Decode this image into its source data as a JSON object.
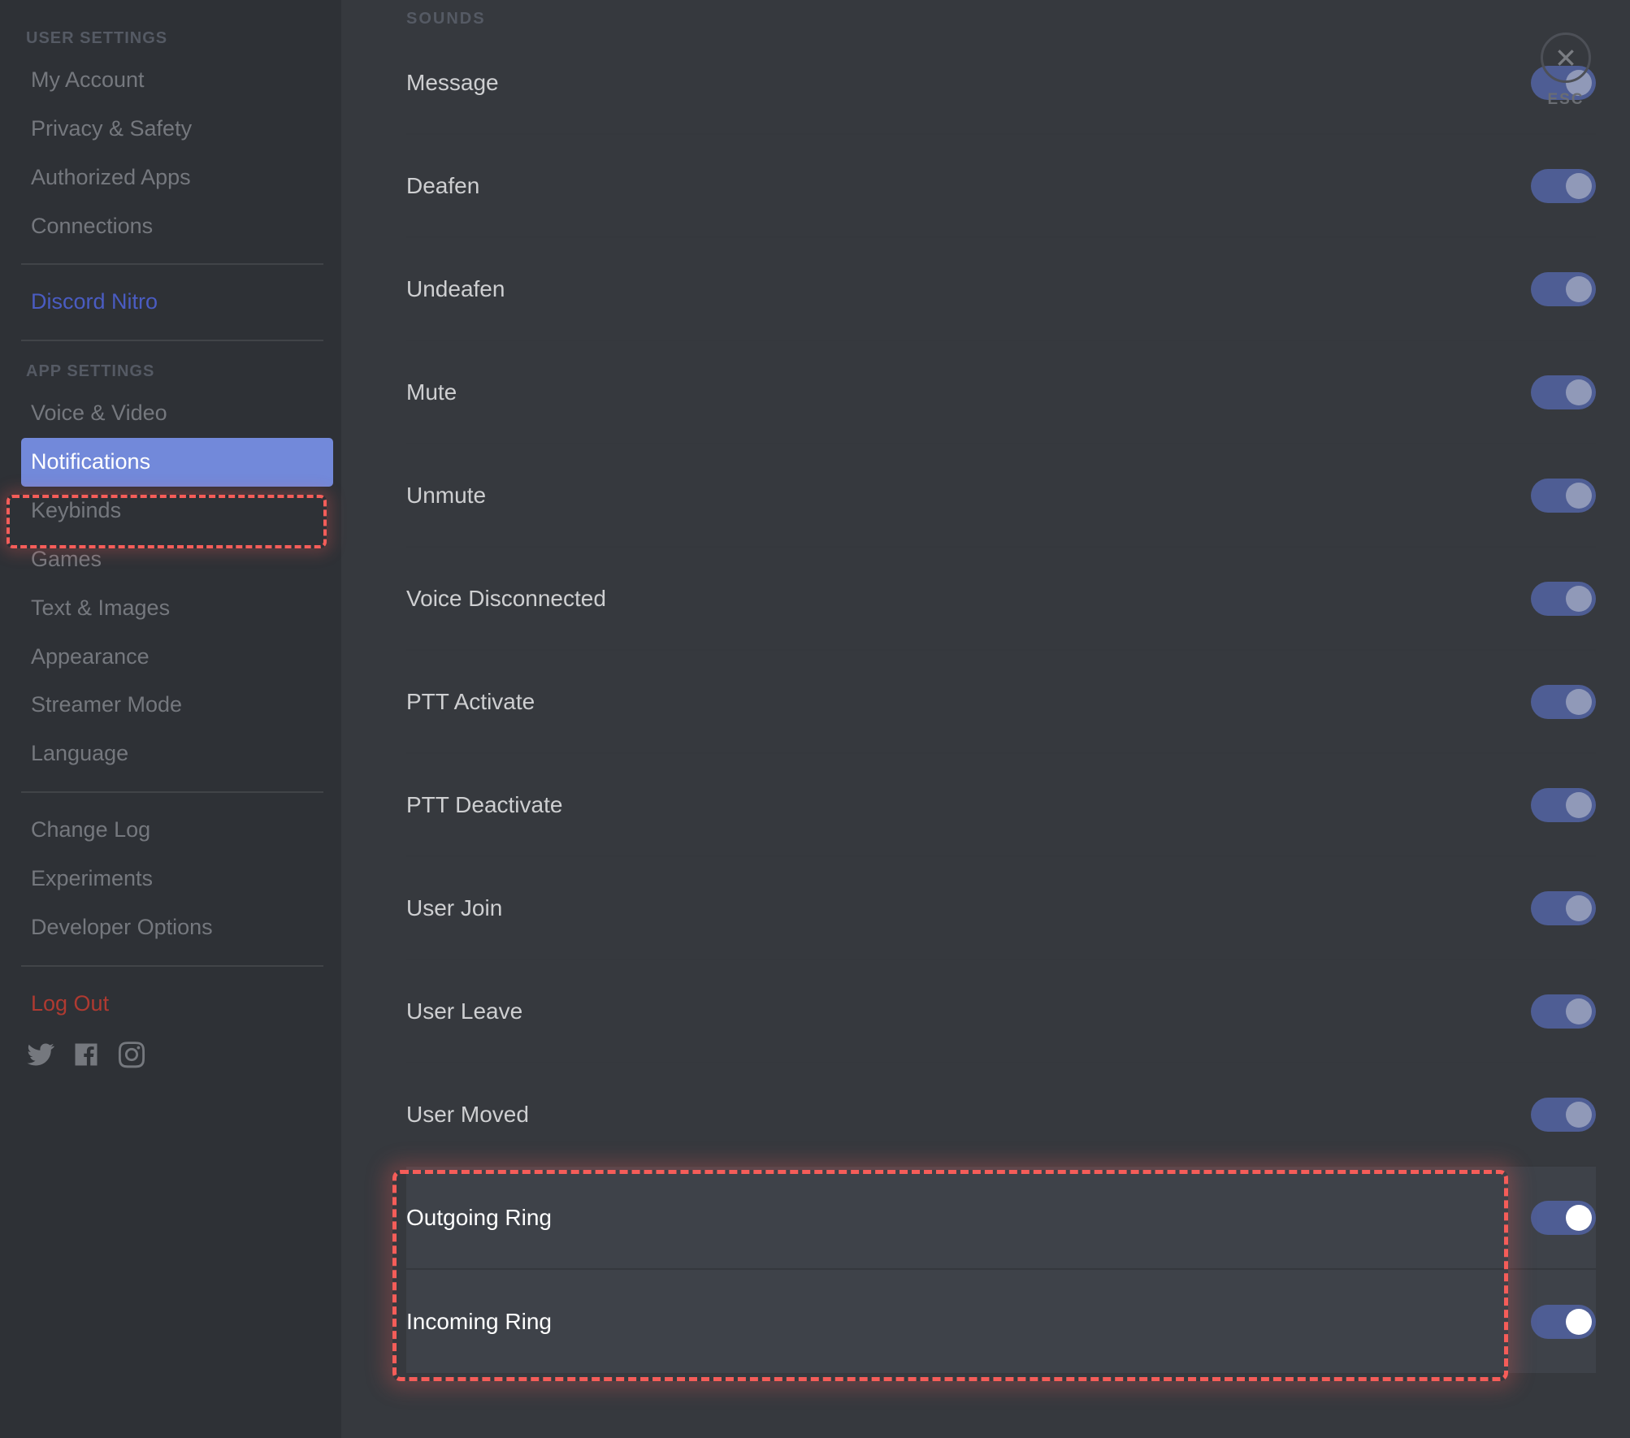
{
  "sidebar": {
    "cat_user": "USER SETTINGS",
    "user_items": [
      {
        "label": "My Account"
      },
      {
        "label": "Privacy & Safety"
      },
      {
        "label": "Authorized Apps"
      },
      {
        "label": "Connections"
      }
    ],
    "nitro": "Discord Nitro",
    "cat_app": "APP SETTINGS",
    "app_items": [
      {
        "label": "Voice & Video"
      },
      {
        "label": "Notifications",
        "selected": true
      },
      {
        "label": "Keybinds"
      },
      {
        "label": "Games"
      },
      {
        "label": "Text & Images"
      },
      {
        "label": "Appearance"
      },
      {
        "label": "Streamer Mode"
      },
      {
        "label": "Language"
      }
    ],
    "misc_items": [
      {
        "label": "Change Log"
      },
      {
        "label": "Experiments"
      },
      {
        "label": "Developer Options"
      }
    ],
    "logout": "Log Out"
  },
  "close": {
    "esc": "ESC"
  },
  "main": {
    "section": "SOUNDS",
    "rows": [
      {
        "label": "Message",
        "on": false,
        "hl": false
      },
      {
        "label": "Deafen",
        "on": false,
        "hl": false
      },
      {
        "label": "Undeafen",
        "on": false,
        "hl": false
      },
      {
        "label": "Mute",
        "on": false,
        "hl": false
      },
      {
        "label": "Unmute",
        "on": false,
        "hl": false
      },
      {
        "label": "Voice Disconnected",
        "on": false,
        "hl": false
      },
      {
        "label": "PTT Activate",
        "on": false,
        "hl": false
      },
      {
        "label": "PTT Deactivate",
        "on": false,
        "hl": false
      },
      {
        "label": "User Join",
        "on": false,
        "hl": false
      },
      {
        "label": "User Leave",
        "on": false,
        "hl": false
      },
      {
        "label": "User Moved",
        "on": false,
        "hl": false
      },
      {
        "label": "Outgoing Ring",
        "on": true,
        "hl": true
      },
      {
        "label": "Incoming Ring",
        "on": true,
        "hl": true
      }
    ]
  }
}
